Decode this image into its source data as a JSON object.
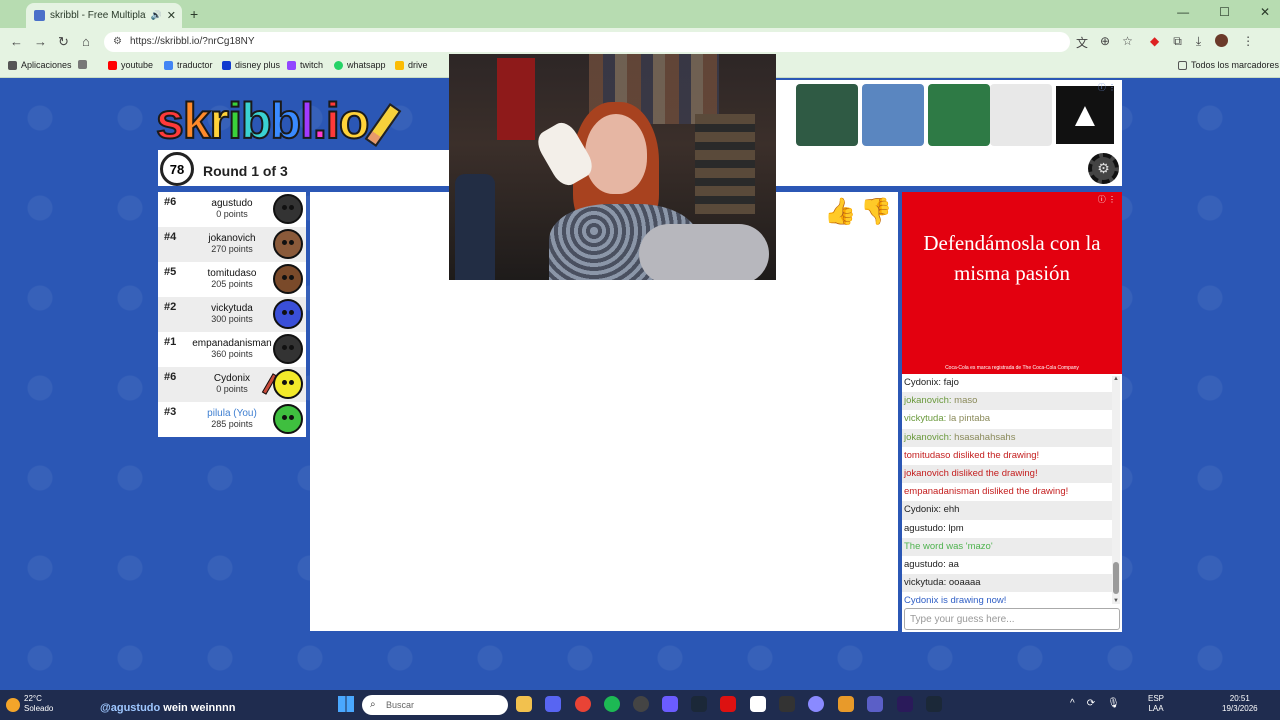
{
  "browser": {
    "tab_title": "skribbl - Free Multiplayer D",
    "url": "https://skribbl.io/?nrCg18NY",
    "bookmarks": [
      {
        "label": "Aplicaciones",
        "color": "#555555"
      },
      {
        "label": "youtube",
        "color": "#ff0000"
      },
      {
        "label": "traductor",
        "color": "#4285f4"
      },
      {
        "label": "disney plus",
        "color": "#113ccf"
      },
      {
        "label": "twitch",
        "color": "#9146ff"
      },
      {
        "label": "whatsapp",
        "color": "#25d366"
      },
      {
        "label": "drive",
        "color": "#fbbc04"
      }
    ],
    "all_bookmarks_label": "Todos los marcadores"
  },
  "game": {
    "logo_text": "skribbl.io",
    "timer": "78",
    "round_label": "Round 1 of 3",
    "players": [
      {
        "rank": "#6",
        "name": "agustudo",
        "points": "0 points",
        "face_color": "#333333",
        "is_me": false,
        "drawing": false
      },
      {
        "rank": "#4",
        "name": "jokanovich",
        "points": "270 points",
        "face_color": "#8a5a3a",
        "is_me": false,
        "drawing": false
      },
      {
        "rank": "#5",
        "name": "tomitudaso",
        "points": "205 points",
        "face_color": "#7a4a2a",
        "is_me": false,
        "drawing": false
      },
      {
        "rank": "#2",
        "name": "vickytuda",
        "points": "300 points",
        "face_color": "#3a4fd8",
        "is_me": false,
        "drawing": false
      },
      {
        "rank": "#1",
        "name": "empanadanisman",
        "points": "360 points",
        "face_color": "#333333",
        "is_me": false,
        "drawing": false
      },
      {
        "rank": "#6",
        "name": "Cydonix",
        "points": "0 points",
        "face_color": "#f3ea2a",
        "is_me": false,
        "drawing": true
      },
      {
        "rank": "#3",
        "name": "pilula (You)",
        "points": "285 points",
        "face_color": "#3fbf3f",
        "is_me": true,
        "drawing": false
      }
    ]
  },
  "chat": {
    "messages": [
      {
        "user": "Cydonix",
        "text": "fajo",
        "style": "m-normal"
      },
      {
        "user": "jokanovich",
        "text": "maso",
        "style": "m-close"
      },
      {
        "user": "vickytuda",
        "text": "la pintaba",
        "style": "m-close"
      },
      {
        "user": "jokanovich",
        "text": "hsasahahsahs",
        "style": "m-close"
      },
      {
        "user": "",
        "text": "tomitudaso disliked the drawing!",
        "style": "m-sys-red"
      },
      {
        "user": "",
        "text": "jokanovich disliked the drawing!",
        "style": "m-sys-red"
      },
      {
        "user": "",
        "text": "empanadanisman disliked the drawing!",
        "style": "m-sys-red"
      },
      {
        "user": "Cydonix",
        "text": "ehh",
        "style": "m-normal"
      },
      {
        "user": "agustudo",
        "text": "lpm",
        "style": "m-normal"
      },
      {
        "user": "",
        "text": "The word was 'mazo'",
        "style": "m-sys-green"
      },
      {
        "user": "agustudo",
        "text": "aa",
        "style": "m-normal"
      },
      {
        "user": "vickytuda",
        "text": "ooaaaa",
        "style": "m-normal"
      },
      {
        "user": "",
        "text": "Cydonix is drawing now!",
        "style": "m-sys-blue"
      }
    ],
    "input_placeholder": "Type your guess here..."
  },
  "ads": {
    "banner_text": "Defendámosla con la misma pasión",
    "fine_print": "Coca-Cola es marca registrada de The Coca-Cola Company",
    "product_colors": [
      "#2f5a44",
      "#5a86c0",
      "#2e7a45",
      "#e8e8e8"
    ]
  },
  "stream": {
    "caption_user": "@agustudo",
    "caption_text": "wein weinnnn"
  },
  "taskbar": {
    "temperature": "22°C",
    "weather": "Soleado",
    "search_placeholder": "Buscar",
    "lang1": "ESP",
    "lang2": "LAA",
    "time": "20:51",
    "date": "19/3/2026"
  }
}
